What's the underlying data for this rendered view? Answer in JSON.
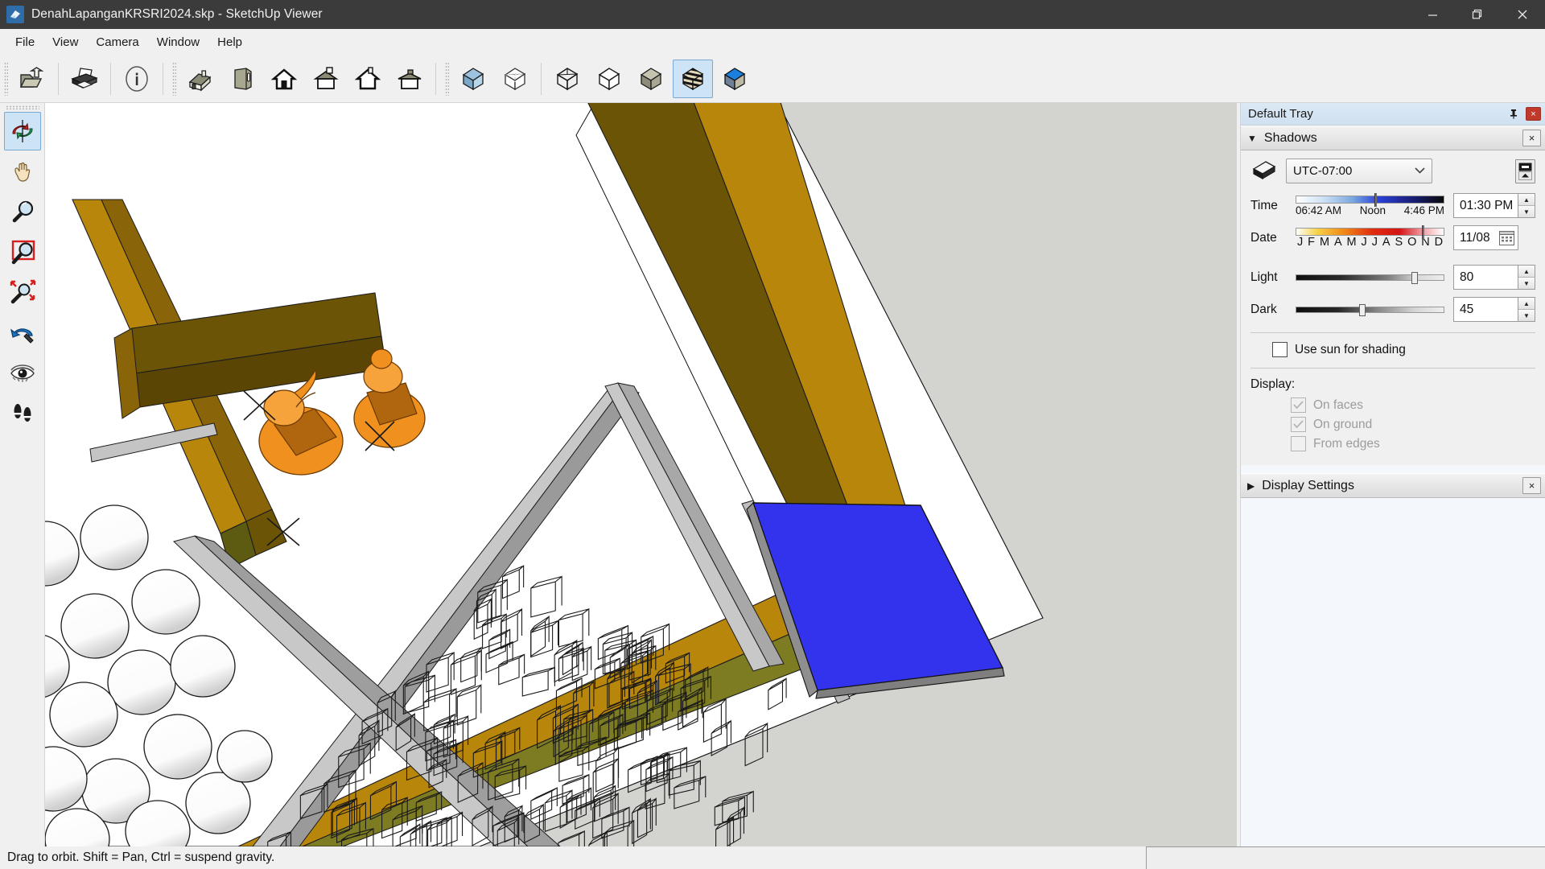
{
  "window": {
    "title": "DenahLapanganKRSRI2024.skp - SketchUp Viewer",
    "app_icon": "sketchup-logo-icon",
    "minimize_label": "—",
    "maximize_label": "❐",
    "close_label": "✕"
  },
  "menu": {
    "items": [
      {
        "label": "File"
      },
      {
        "label": "View"
      },
      {
        "label": "Camera"
      },
      {
        "label": "Window"
      },
      {
        "label": "Help"
      }
    ]
  },
  "toolbar": {
    "buttons": [
      {
        "name": "open-file-icon",
        "tooltip": "Open"
      },
      {
        "name": "print-icon",
        "tooltip": "Print"
      },
      {
        "name": "info-icon",
        "tooltip": "Model Info"
      },
      {
        "name": "view-iso-icon",
        "tooltip": "Iso"
      },
      {
        "name": "view-front-icon",
        "tooltip": "Front"
      },
      {
        "name": "view-back-icon",
        "tooltip": "Back"
      },
      {
        "name": "view-top-icon",
        "tooltip": "Top"
      },
      {
        "name": "view-left-icon",
        "tooltip": "Left"
      },
      {
        "name": "view-right-icon",
        "tooltip": "Right"
      },
      {
        "name": "style-xray-icon",
        "tooltip": "X-ray"
      },
      {
        "name": "style-back-edges-icon",
        "tooltip": "Back Edges"
      },
      {
        "name": "style-wireframe-icon",
        "tooltip": "Wireframe"
      },
      {
        "name": "style-hidden-line-icon",
        "tooltip": "Hidden Line"
      },
      {
        "name": "style-shaded-icon",
        "tooltip": "Shaded"
      },
      {
        "name": "style-textures-icon",
        "tooltip": "Shaded With Textures",
        "active": true
      },
      {
        "name": "style-monochrome-icon",
        "tooltip": "Monochrome"
      }
    ]
  },
  "left_toolbar": {
    "buttons": [
      {
        "name": "orbit-tool-icon",
        "tooltip": "Orbit",
        "active": true
      },
      {
        "name": "pan-tool-icon",
        "tooltip": "Pan"
      },
      {
        "name": "zoom-tool-icon",
        "tooltip": "Zoom"
      },
      {
        "name": "zoom-window-tool-icon",
        "tooltip": "Zoom Window"
      },
      {
        "name": "zoom-extents-tool-icon",
        "tooltip": "Zoom Extents"
      },
      {
        "name": "previous-view-icon",
        "tooltip": "Previous"
      },
      {
        "name": "look-around-tool-icon",
        "tooltip": "Look Around"
      },
      {
        "name": "walk-tool-icon",
        "tooltip": "Walk"
      }
    ]
  },
  "tray": {
    "title": "Default Tray",
    "pin_icon": "pin-icon",
    "close_label": "×",
    "shadows": {
      "expanded": true,
      "triangle": "▼",
      "title": "Shadows",
      "close_label": "×",
      "shadow_icon": "shadow-settings-icon",
      "timezone": {
        "value": "UTC-07:00",
        "caret": "⌄"
      },
      "toggle_shadows_icon": "toggle-shadows-icon",
      "time": {
        "label": "Time",
        "value": "01:30 PM",
        "ticks": [
          "06:42 AM",
          "Noon",
          "4:46 PM"
        ],
        "thumb_percent": 53
      },
      "date": {
        "label": "Date",
        "value": "11/08",
        "months": [
          "J",
          "F",
          "M",
          "A",
          "M",
          "J",
          "J",
          "A",
          "S",
          "O",
          "N",
          "D"
        ],
        "thumb_percent": 85,
        "calendar_icon": "calendar-icon"
      },
      "light": {
        "label": "Light",
        "value": "80",
        "percent": 80
      },
      "dark": {
        "label": "Dark",
        "value": "45",
        "percent": 45
      },
      "use_sun": {
        "label": "Use sun for shading",
        "checked": false
      },
      "display_label": "Display:",
      "display_options": [
        {
          "label": "On faces",
          "checked": true,
          "disabled": true
        },
        {
          "label": "On ground",
          "checked": true,
          "disabled": true
        },
        {
          "label": "From edges",
          "checked": false,
          "disabled": true
        }
      ]
    },
    "display_settings": {
      "expanded": false,
      "triangle": "▶",
      "title": "Display Settings",
      "close_label": "×"
    }
  },
  "status": {
    "text": "Drag to orbit. Shift = Pan, Ctrl = suspend gravity."
  },
  "viewport": {
    "name": "sketchup-3d-viewport",
    "background_color": "#d3d3d0",
    "field_color": "#ffffff",
    "wall_color": "#b8860b",
    "wall_shade_color": "#6b5406",
    "wall_top_color": "#7d7c22",
    "curb_color": "#c8c8c8",
    "curb_side_color": "#9a9a9a",
    "blue_zone_color": "#3333ee",
    "figure_color": "#f0901e",
    "figure_dark_color": "#a85c10"
  }
}
